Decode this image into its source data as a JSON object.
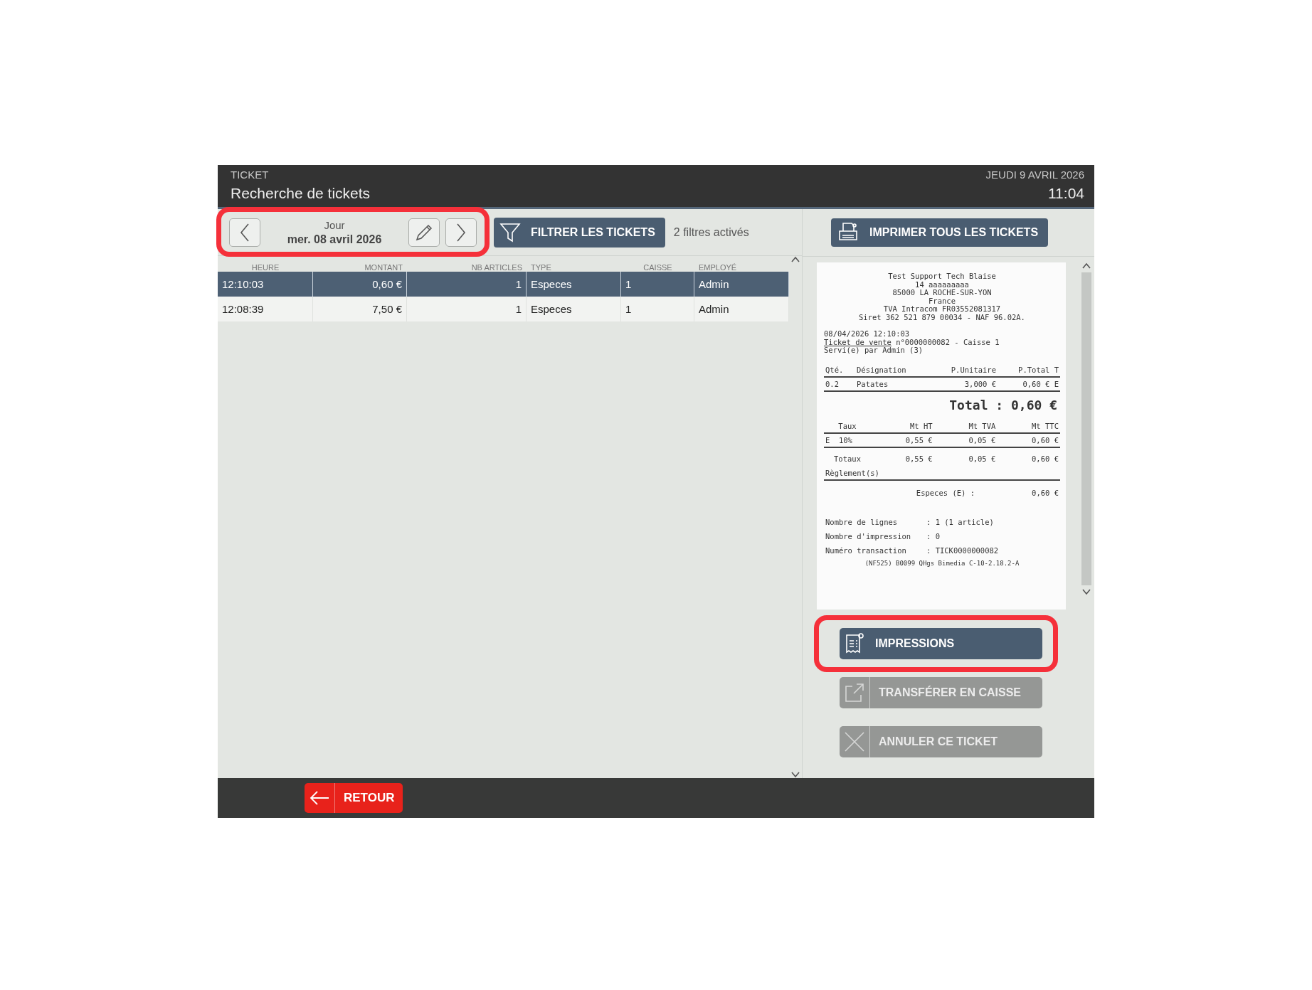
{
  "header": {
    "section": "TICKET",
    "title": "Recherche de tickets",
    "date": "JEUDI 9 AVRIL 2026",
    "time": "11:04"
  },
  "date_nav": {
    "label": "Jour",
    "value": "mer. 08 avril 2026",
    "highlighted": true
  },
  "filter": {
    "button": "FILTRER LES TICKETS",
    "status": "2 filtres activés"
  },
  "print_all": "IMPRIMER TOUS LES TICKETS",
  "table": {
    "columns": [
      "HEURE",
      "MONTANT",
      "NB ARTICLES",
      "TYPE",
      "CAISSE",
      "EMPLOYÉ"
    ],
    "rows": [
      {
        "selected": true,
        "cells": [
          "12:10:03",
          "0,60 €",
          "1",
          "Especes",
          "1",
          "Admin"
        ]
      },
      {
        "selected": false,
        "cells": [
          "12:08:39",
          "7,50 €",
          "1",
          "Especes",
          "1",
          "Admin"
        ]
      }
    ]
  },
  "receipt": {
    "header_lines": [
      "Test Support Tech Blaise",
      "14 aaaaaaaaa",
      "85000 LA ROCHE-SUR-YON",
      "France",
      "TVA Intracom FR03552081317",
      "Siret 362 521 879 00034 - NAF 96.02A."
    ],
    "datetime": "08/04/2026 12:10:03",
    "sale_link": "Ticket de vente",
    "sale_rest": "n°0000000082 - Caisse 1",
    "served": "Servi(e) par Admin (3)",
    "item_columns": [
      "Qté.",
      "Désignation",
      "P.Unitaire",
      "P.Total T"
    ],
    "items": [
      [
        "0.2",
        "Patates",
        "3,000 €",
        "0,60 € E"
      ]
    ],
    "total": "Total : 0,60 €",
    "tax_columns": [
      "Taux",
      "Mt HT",
      "Mt TVA",
      "Mt TTC"
    ],
    "tax_rows": [
      [
        "E  10%",
        "0,55 €",
        "0,05 €",
        "0,60 €"
      ]
    ],
    "tax_totals": [
      "Totaux",
      "0,55 €",
      "0,05 €",
      "0,60 €"
    ],
    "payments_label": "Règlement(s)",
    "payments": [
      {
        "label": "Especes (E) :",
        "amount": "0,60 €"
      }
    ],
    "info": [
      {
        "label": "Nombre de lignes",
        "value": ": 1 (1 article)"
      },
      {
        "label": "Nombre d'impression",
        "value": ": 0"
      },
      {
        "label": "Numéro transaction",
        "value": ": TICK0000000082"
      }
    ],
    "footer": "(NF525) B0099 QHgs Bimedia C-10-2.18.2-A"
  },
  "actions": [
    {
      "kind": "print",
      "label": "IMPRESSIONS",
      "disabled": false,
      "highlighted": true
    },
    {
      "kind": "transfer",
      "label": "TRANSFÉRER EN CAISSE",
      "disabled": true,
      "highlighted": false
    },
    {
      "kind": "cancel",
      "label": "ANNULER CE TICKET",
      "disabled": true,
      "highlighted": false
    }
  ],
  "back_button": "RETOUR"
}
